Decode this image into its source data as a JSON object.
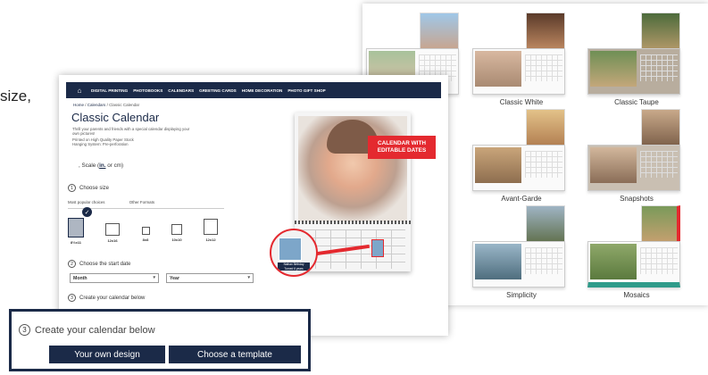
{
  "caption_text": "size,",
  "nav": {
    "items": [
      "DIGITAL PRINTING",
      "PHOTOBOOKS",
      "CALENDARS",
      "GREETING CARDS",
      "HOME DECORATION",
      "PHOTO GIFT SHOP"
    ]
  },
  "breadcrumb": {
    "home": "Home",
    "section": "Calendars",
    "current": "Classic Calendar"
  },
  "product": {
    "title": "Classic Calendar",
    "description": "Thrill your parents and friends with a special calendar displaying your own pictures!",
    "spec1": "Printed on High Quality Paper Stock",
    "spec2": "Hanging System: Pre-perforation",
    "scale_prefix": ", Scale (",
    "scale_unit_in": "in.",
    "scale_suffix": " or cm)"
  },
  "steps": {
    "size": {
      "num": "1",
      "label": "Choose size"
    },
    "date": {
      "num": "2",
      "label": "Choose the start date"
    },
    "create": {
      "num": "3",
      "label": "Create your calendar below"
    }
  },
  "size_tabs": [
    "Most popular choices",
    "Other Formats"
  ],
  "sizes": [
    {
      "label": "8½x11",
      "selected": true
    },
    {
      "label": "12x16",
      "selected": false
    },
    {
      "label": "8x8",
      "selected": false
    },
    {
      "label": "10x10",
      "selected": false
    },
    {
      "label": "12x12",
      "selected": false
    }
  ],
  "selects": {
    "month": "Month",
    "year": "Year"
  },
  "ribbon": {
    "line1": "CALENDAR WITH",
    "line2": "EDITABLE DATES"
  },
  "zoom_label": {
    "line1": "Nathan Birthday",
    "line2": "Turned 6 years"
  },
  "callout": {
    "step_num": "3",
    "step_label": "Create your calendar below",
    "btn_own": "Your own design",
    "btn_template": "Choose a template"
  },
  "templates": [
    "Classic White",
    "Classic Taupe",
    "Avant-Garde",
    "Snapshots",
    "Simplicity",
    "Mosaics"
  ],
  "colors": {
    "navy": "#1b2a48",
    "accent_red": "#e4292f"
  }
}
